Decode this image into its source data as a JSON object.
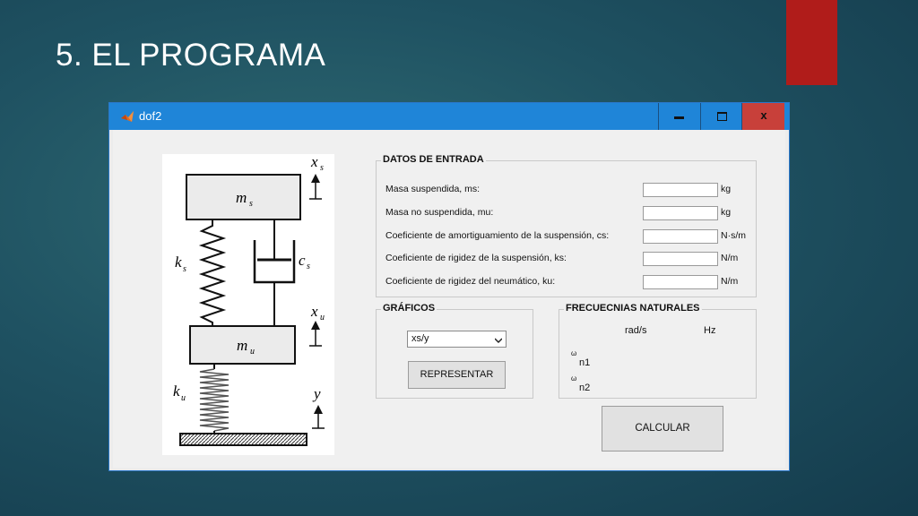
{
  "slide": {
    "title": "5. EL PROGRAMA",
    "accent_color": "#b01c1a"
  },
  "window": {
    "title": "dof2",
    "icon": "matlab-logo-icon",
    "controls": {
      "minimize": "minimize-icon",
      "maximize": "maximize-icon",
      "close_label": "x"
    }
  },
  "diagram": {
    "labels": {
      "xs": "x",
      "xs_sub": "s",
      "ms": "m",
      "ms_sub": "s",
      "ks": "k",
      "ks_sub": "s",
      "cs": "c",
      "cs_sub": "s",
      "xu": "x",
      "xu_sub": "u",
      "mu": "m",
      "mu_sub": "u",
      "ku": "k",
      "ku_sub": "u",
      "y": "y"
    }
  },
  "datos_entrada": {
    "legend": "DATOS DE ENTRADA",
    "fields": [
      {
        "label": "Masa suspendida, ms:",
        "value": "",
        "unit": "kg"
      },
      {
        "label": "Masa no suspendida, mu:",
        "value": "",
        "unit": "kg"
      },
      {
        "label": "Coeficiente de amortiguamiento de la suspensión, cs:",
        "value": "",
        "unit": "N·s/m"
      },
      {
        "label": "Coeficiente de rigidez de la suspensión, ks:",
        "value": "",
        "unit": "N/m"
      },
      {
        "label": "Coeficiente de rigidez del neumático, ku:",
        "value": "",
        "unit": "N/m"
      }
    ]
  },
  "graficos": {
    "legend": "GRÁFICOS",
    "selected": "xs/y",
    "button": "REPRESENTAR"
  },
  "frecuencias": {
    "legend": "FRECUECNIAS NATURALES",
    "col_rad": "rad/s",
    "col_hz": "Hz",
    "rows": [
      {
        "symbol": "ω",
        "sub": "n1"
      },
      {
        "symbol": "ω",
        "sub": "n2"
      }
    ]
  },
  "calcular_button": "CALCULAR"
}
